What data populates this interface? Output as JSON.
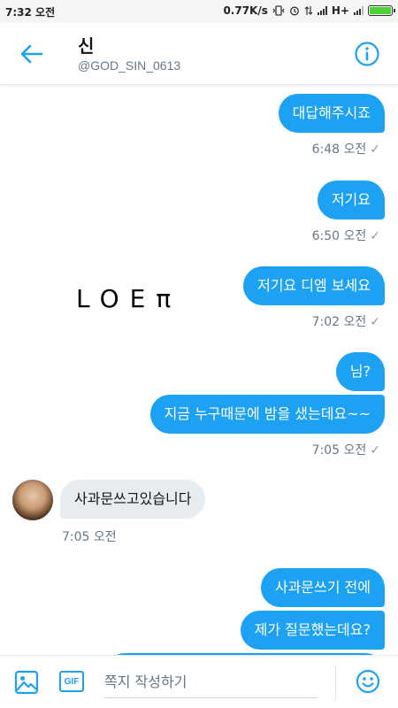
{
  "status_bar": {
    "time": "7:32 오전",
    "speed": "0.77K/s",
    "network": "H+"
  },
  "header": {
    "name": "신",
    "handle": "@GOD_SIN_0613"
  },
  "logo_text": "LOEπ",
  "messages": [
    {
      "dir": "out",
      "text": "대답해주시죠",
      "time": "6:48 오전"
    },
    {
      "dir": "out",
      "text": "저기요",
      "time": "6:50 오전"
    },
    {
      "dir": "out",
      "text": "저기요 디엠 보세요",
      "time": "7:02 오전"
    },
    {
      "dir": "out",
      "text": "님?"
    },
    {
      "dir": "out",
      "text": "지금 누구때문에 밤을 샜는데요~~",
      "time": "7:05 오전"
    },
    {
      "dir": "in",
      "text": "사과문쓰고있습니다",
      "time": "7:05 오전"
    },
    {
      "dir": "out",
      "text": "사과문쓰기 전에"
    },
    {
      "dir": "out",
      "text": "제가 질문했는데요?"
    }
  ],
  "composer": {
    "gif_label": "GIF",
    "placeholder": "쪽지 작성하기"
  },
  "colors": {
    "accent": "#1da1f2",
    "incoming_bubble": "#e6ecf0",
    "battery": "#4cd137"
  }
}
